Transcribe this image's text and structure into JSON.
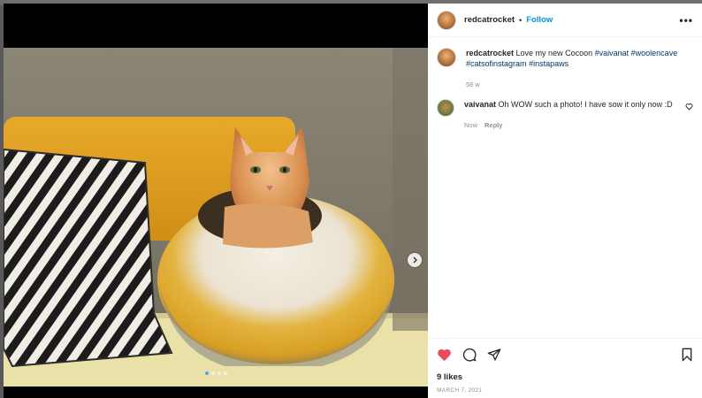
{
  "post": {
    "username": "redcatrocket",
    "separator": "•",
    "follow_label": "Follow",
    "more_label": "•••",
    "caption": {
      "username": "redcatrocket",
      "text": "Love my new Cocoon",
      "hashtags": [
        "#vaivanat",
        "#woolencave",
        "#catsofinstagram",
        "#instapaws"
      ],
      "age": "58 w"
    },
    "comments": [
      {
        "username": "vaivanat",
        "text": "Oh WOW such a photo! I have sow it only now :D",
        "time": "Now",
        "reply_label": "Reply"
      }
    ],
    "likes": "9 likes",
    "date": "MARCH 7, 2021",
    "liked": true,
    "carousel": {
      "slides": 4,
      "current": 1
    }
  },
  "icons": {
    "like": "heart-filled-icon",
    "comment": "comment-bubble-icon",
    "share": "paper-plane-icon",
    "save": "bookmark-icon",
    "next": "chevron-right-icon",
    "comment_like": "heart-outline-icon"
  },
  "colors": {
    "accent": "#0095f6",
    "like_red": "#ed4956",
    "hashtag": "#00376b",
    "muted": "#8e8e8e",
    "text": "#262626"
  }
}
